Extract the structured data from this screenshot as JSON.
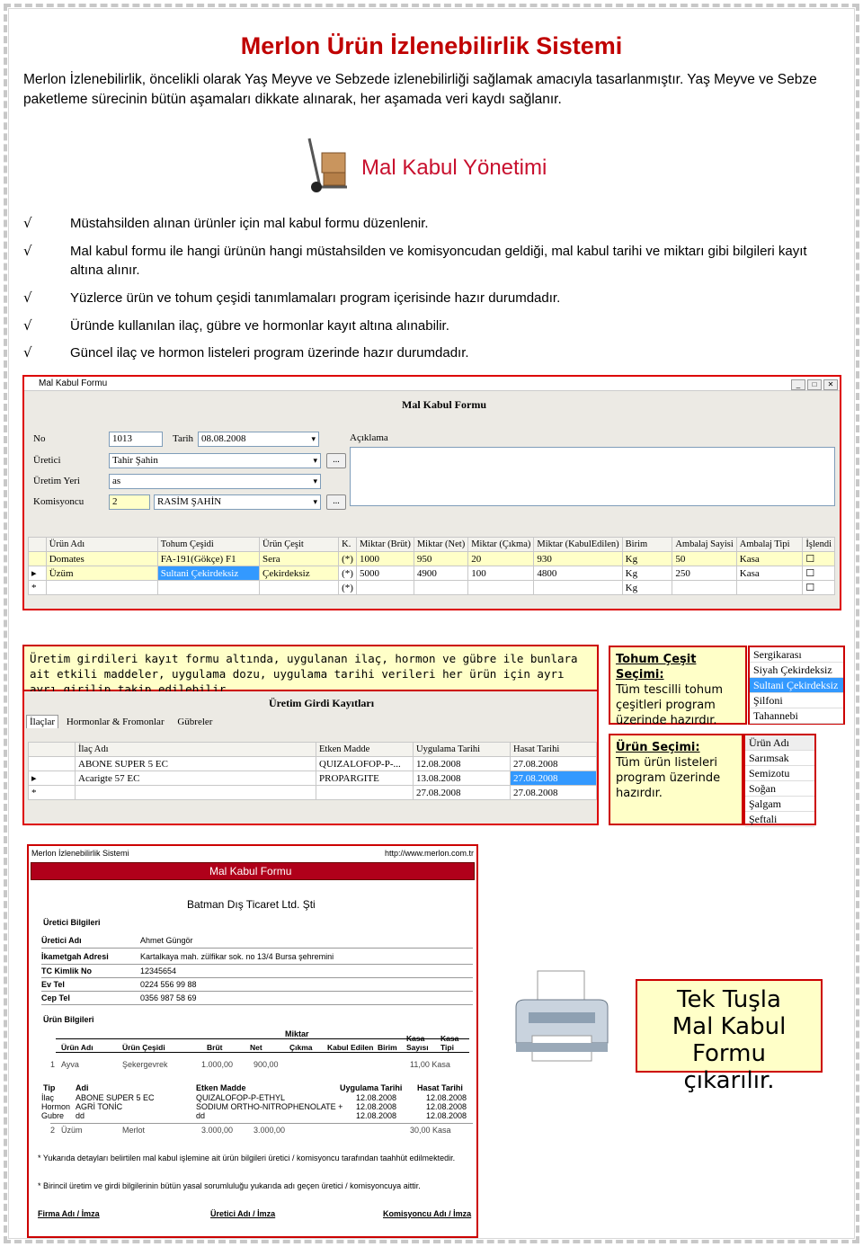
{
  "header": {
    "title": "Merlon Ürün İzlenebilirlik Sistemi",
    "intro": "Merlon İzlenebilirlik, öncelikli olarak Yaş Meyve ve Sebzede izlenebilirliği sağlamak amacıyla tasarlanmıştır. Yaş Meyve ve Sebze paketleme sürecinin bütün aşamaları dikkate alınarak, her aşamada veri kaydı sağlanır."
  },
  "section": {
    "title": "Mal Kabul Yönetimi",
    "icon": "hand-truck-icon"
  },
  "check": "√",
  "bullets": [
    "Müstahsilden alınan ürünler için mal kabul formu düzenlenir.",
    "Mal kabul formu ile hangi ürünün hangi müstahsilden ve komisyoncudan geldiği, mal kabul tarihi ve miktarı gibi bilgileri kayıt altına alınır.",
    "Yüzlerce ürün ve tohum çeşidi tanımlamaları program içerisinde hazır durumdadır.",
    "Üründe kullanılan ilaç, gübre ve hormonlar kayıt altına alınabilir.",
    "Güncel ilaç ve hormon listeleri program üzerinde hazır durumdadır."
  ],
  "form": {
    "window_title": "Mal Kabul Formu",
    "heading": "Mal Kabul Formu",
    "no_label": "No",
    "no_value": "1013",
    "tarih_label": "Tarih",
    "tarih_value": "08.08.2008",
    "aciklama_label": "Açıklama",
    "uretici_label": "Üretici",
    "uretici_value": "Tahir Şahin",
    "uretim_yeri_label": "Üretim Yeri",
    "uretim_yeri_value": "as",
    "komisyoncu_label": "Komisyoncu",
    "komisyoncu_code": "2",
    "komisyoncu_value": "RASİM ŞAHİN",
    "ellipsis": "...",
    "columns": [
      "Ürün Adı",
      "Tohum Çeşidi",
      "Ürün Çeşit",
      "K.",
      "Miktar (Brüt)",
      "Miktar (Net)",
      "Miktar (Çıkma)",
      "Miktar (KabulEdilen)",
      "Birim",
      "Ambalaj Sayisi",
      "Ambalaj Tipi",
      "İşlendi"
    ],
    "rows": [
      {
        "marker": "",
        "urun": "Domates",
        "tohum": "FA-191(Gökçe) F1",
        "cesit": "Sera",
        "k": "(*)",
        "brut": "1000",
        "net": "950",
        "cikma": "20",
        "kabul": "930",
        "birim": "Kg",
        "amb_sayi": "50",
        "amb_tip": "Kasa"
      },
      {
        "marker": "▸",
        "urun": "Üzüm",
        "tohum": "Sultani Çekirdeksiz",
        "cesit": "Çekirdeksiz",
        "k": "(*)",
        "brut": "5000",
        "net": "4900",
        "cikma": "100",
        "kabul": "4800",
        "birim": "Kg",
        "amb_sayi": "250",
        "amb_tip": "Kasa"
      },
      {
        "marker": "*",
        "urun": "",
        "tohum": "",
        "cesit": "",
        "k": "(*)",
        "brut": "",
        "net": "",
        "cikma": "",
        "kabul": "",
        "birim": "Kg",
        "amb_sayi": "",
        "amb_tip": ""
      }
    ]
  },
  "note1": "Üretim girdileri kayıt formu altında, uygulanan ilaç, hormon ve gübre ile bunlara ait etkili maddeler, uygulama dozu, uygulama tarihi verileri her ürün için ayrı ayrı girilip takip edilebilir.",
  "girdi": {
    "heading": "Üretim Girdi Kayıtları",
    "tabs": [
      "İlaçlar",
      "Hormonlar & Fromonlar",
      "Gübreler"
    ],
    "columns": [
      "İlaç Adı",
      "Etken Madde",
      "Uygulama Tarihi",
      "Hasat Tarihi"
    ],
    "rows": [
      {
        "marker": "",
        "ilac": "ABONE SUPER 5 EC",
        "etken": "QUIZALOFOP-P-...",
        "uyg": "12.08.2008",
        "hasat": "27.08.2008"
      },
      {
        "marker": "▸",
        "ilac": "Acarigte 57 EC",
        "etken": "PROPARGITE",
        "uyg": "13.08.2008",
        "hasat": "27.08.2008"
      },
      {
        "marker": "*",
        "ilac": "",
        "etken": "",
        "uyg": "27.08.2008",
        "hasat": "27.08.2008"
      }
    ]
  },
  "tohum_box": {
    "title": "Tohum Çeşit Seçimi:",
    "text": "Tüm tescilli tohum çeşitleri program üzerinde hazırdır.",
    "items": [
      "Sergikarası",
      "Siyah Çekirdeksiz",
      "Sultani Çekirdeksiz",
      "Şilfoni",
      "Tahannebi"
    ],
    "selected": 2
  },
  "urun_box": {
    "title": "Ürün Seçimi:",
    "text": "Tüm ürün listeleri program üzerinde hazırdır.",
    "items": [
      "Ürün Adı",
      "Sarımsak",
      "Semizotu",
      "Soğan",
      "Şalgam",
      "Şeftali"
    ]
  },
  "report": {
    "app": "Merlon İzlenebilirlik Sistemi",
    "url": "http://www.merlon.com.tr",
    "banner": "Mal Kabul Formu",
    "company": "Batman Dış Ticaret Ltd. Şti",
    "uretici_section": "Üretici Bilgileri",
    "fields": [
      {
        "label": "Üretici Adı",
        "value": "Ahmet Güngör"
      },
      {
        "label": "İkametgah Adresi",
        "value": "Kartalkaya mah. zülfikar sok. no 13/4 Bursa şehremini"
      },
      {
        "label": "TC Kimlik No",
        "value": "12345654"
      },
      {
        "label": "Ev Tel",
        "value": "0224 556 99 88"
      },
      {
        "label": "Cep Tel",
        "value": "0356 987 58 69"
      }
    ],
    "urun_section": "Ürün Bilgileri",
    "miktar": "Miktar",
    "cols": [
      "Ürün Adı",
      "Ürün Çeşidi",
      "Brüt",
      "Net",
      "Çıkma",
      "Kabul Edilen",
      "Birim",
      "Kasa Sayısı",
      "Kasa Tipi"
    ],
    "r1": {
      "no": "1",
      "urun": "Ayva",
      "cesit": "Şekergevrek",
      "brut": "1.000,00",
      "net": "900,00",
      "kasa": "11,00 Kasa"
    },
    "sub_cols": [
      "Tip",
      "Adi",
      "Etken Madde",
      "Uygulama Tarihi",
      "Hasat Tarihi"
    ],
    "subrows": [
      {
        "tip": "İlaç",
        "adi": "ABONE SUPER 5 EC",
        "etken": "QUIZALOFOP-P-ETHYL",
        "uyg": "12.08.2008",
        "hasat": "12.08.2008"
      },
      {
        "tip": "Hormon",
        "adi": "AGRİ TONİC",
        "etken": "SODIUM ORTHO-NITROPHENOLATE +",
        "uyg": "12.08.2008",
        "hasat": "12.08.2008"
      },
      {
        "tip": "Gubre",
        "adi": "dd",
        "etken": "dd",
        "uyg": "12.08.2008",
        "hasat": "12.08.2008"
      }
    ],
    "r2": {
      "no": "2",
      "urun": "Üzüm",
      "cesit": "Merlot",
      "brut": "3.000,00",
      "net": "3.000,00",
      "kasa": "30,00 Kasa"
    },
    "foot1": "* Yukarıda detayları belirtilen mal kabul işlemine ait ürün bilgileri üretici / komisyoncu tarafından taahhüt edilmektedir.",
    "foot2": "* Birincil üretim ve girdi bilgilerinin bütün yasal sorumluluğu yukarıda adı geçen üretici / komisyoncuya aittir.",
    "sign": [
      "Firma Adı / İmza",
      "Üretici Adı / İmza",
      "Komisyoncu Adı / İmza"
    ]
  },
  "print": {
    "icon": "printer-icon",
    "l1": "Tek Tuşla",
    "l2": "Mal Kabul Formu",
    "l3": "çıkarılır."
  }
}
